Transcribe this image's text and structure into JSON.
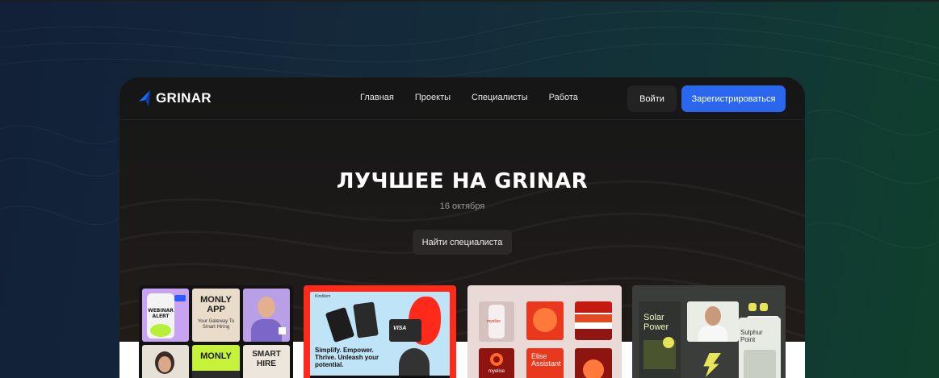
{
  "brand": {
    "name": "GRINAR"
  },
  "nav": {
    "items": [
      {
        "label": "Главная"
      },
      {
        "label": "Проекты"
      },
      {
        "label": "Специалисты"
      },
      {
        "label": "Работа"
      }
    ],
    "login_label": "Войти",
    "register_label": "Зарегистрироваться"
  },
  "hero": {
    "title": "ЛУЧШЕЕ НА GRINAR",
    "date": "16 октября",
    "cta_label": "Найти специалиста"
  },
  "cards": {
    "c1": {
      "webinar": "WEBINAR ALERT",
      "monly_app": "MONLY APP",
      "monly_tagline": "Your Gateway To Smart Hiring",
      "monly": "MONLY",
      "smart_hire": "SMART HIRE"
    },
    "c2": {
      "header": "Kinditem",
      "headline": "Simplify. Empower. Thrive. Unleash your potential.",
      "visa": "VISA"
    },
    "c3": {
      "brand": "myelise",
      "assistant": "Elise Assistant"
    },
    "c4": {
      "solar": "Solar Power",
      "sulphur_point": "Sulphur Point"
    }
  },
  "colors": {
    "accent": "#2a66ee",
    "logo_blue": "#1f6bff"
  }
}
